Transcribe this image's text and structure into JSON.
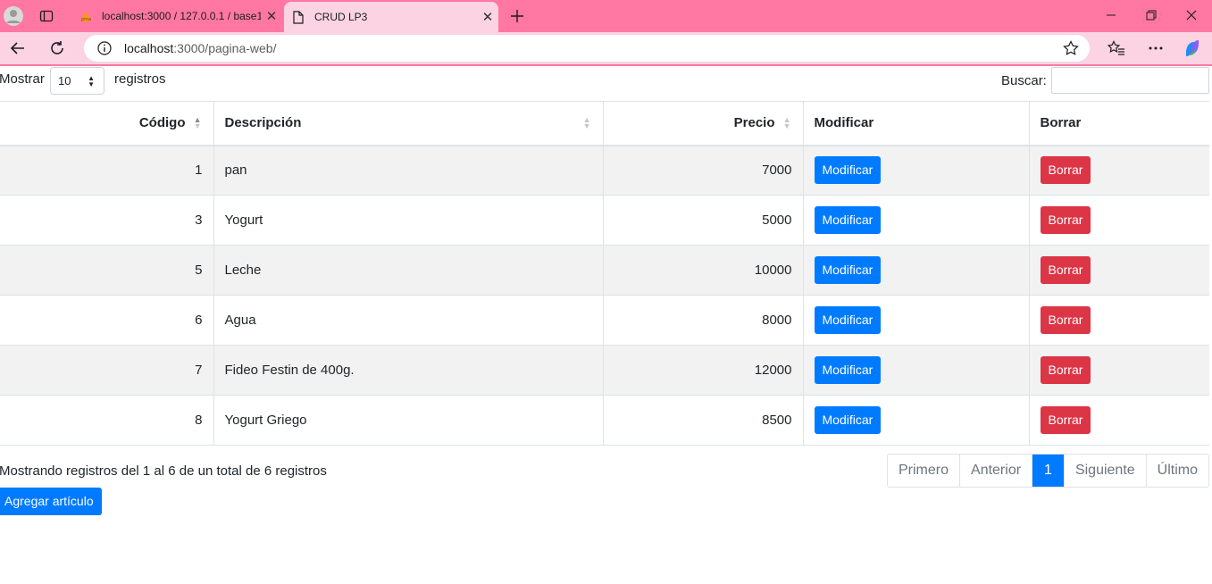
{
  "browser": {
    "tabs": [
      {
        "title": "localhost:3000 / 127.0.0.1 / base1"
      },
      {
        "title": "CRUD LP3"
      }
    ],
    "url_host": "localhost",
    "url_rest": ":3000/pagina-web/"
  },
  "controls": {
    "show_label": "Mostrar",
    "page_length": "10",
    "records_label": "registros",
    "search_label": "Buscar:",
    "search_value": ""
  },
  "table": {
    "headers": {
      "code": "Código",
      "description": "Descripción",
      "price": "Precio",
      "modify": "Modificar",
      "delete": "Borrar"
    },
    "rows": [
      {
        "code": "1",
        "description": "pan",
        "price": "7000",
        "modify": "Modificar",
        "delete": "Borrar"
      },
      {
        "code": "3",
        "description": "Yogurt",
        "price": "5000",
        "modify": "Modificar",
        "delete": "Borrar"
      },
      {
        "code": "5",
        "description": "Leche",
        "price": "10000",
        "modify": "Modificar",
        "delete": "Borrar"
      },
      {
        "code": "6",
        "description": "Agua",
        "price": "8000",
        "modify": "Modificar",
        "delete": "Borrar"
      },
      {
        "code": "7",
        "description": "Fideo Festin de 400g.",
        "price": "12000",
        "modify": "Modificar",
        "delete": "Borrar"
      },
      {
        "code": "8",
        "description": "Yogurt Griego",
        "price": "8500",
        "modify": "Modificar",
        "delete": "Borrar"
      }
    ]
  },
  "footer": {
    "info": "Mostrando registros del 1 al 6 de un total de 6 registros",
    "pagination": [
      "Primero",
      "Anterior",
      "1",
      "Siguiente",
      "Último"
    ],
    "current_page": "1",
    "add_button": "Agregar artículo"
  },
  "colors": {
    "titlebar": "#ff77a2",
    "toolbar": "#fbd3e3",
    "primary": "#007bff",
    "danger": "#dc3545"
  }
}
